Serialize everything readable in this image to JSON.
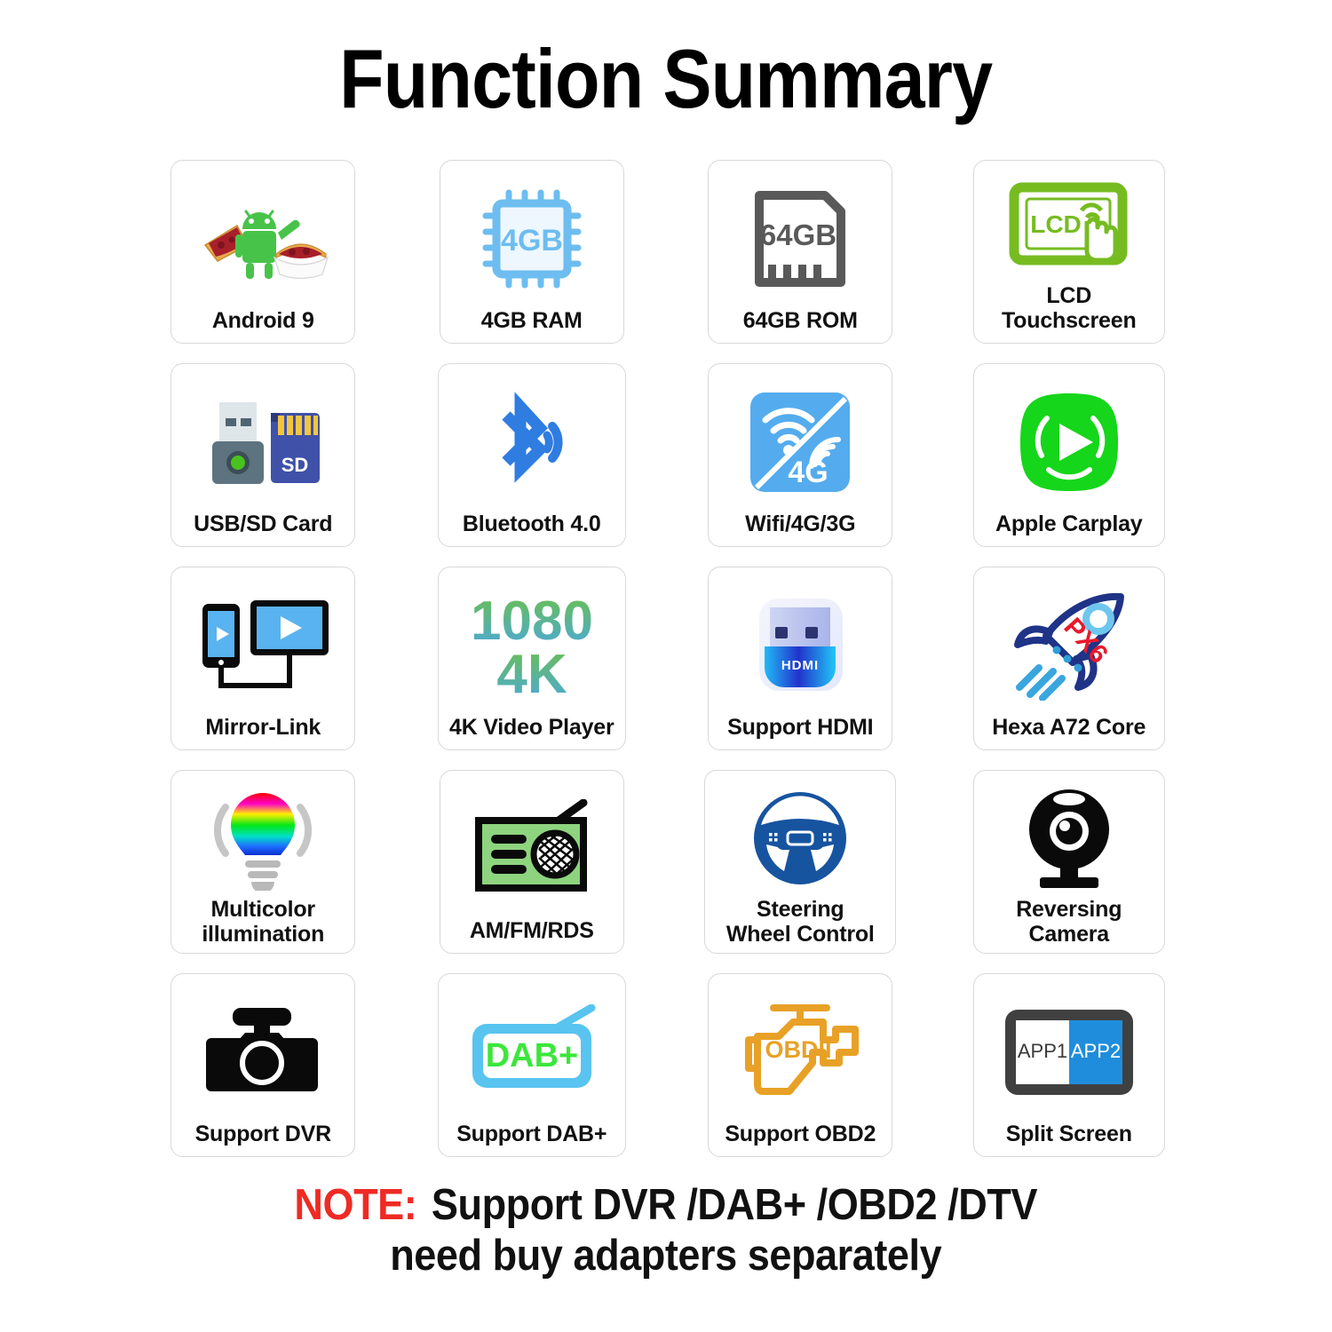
{
  "header": {
    "title": "Function Summary"
  },
  "features": [
    {
      "id": "android",
      "label": "Android 9",
      "icon": "android-pie-icon",
      "card_width": "normal"
    },
    {
      "id": "ram",
      "label": "4GB RAM",
      "icon": "cpu-chip-icon",
      "card_width": "normal",
      "badge": "4GB"
    },
    {
      "id": "rom",
      "label": "64GB ROM",
      "icon": "sd-card-icon",
      "card_width": "normal",
      "badge": "64GB"
    },
    {
      "id": "lcd",
      "label": "LCD Touchscreen",
      "icon": "lcd-touchscreen-icon",
      "card_width": "wider",
      "badge": "LCD"
    },
    {
      "id": "usbsd",
      "label": "USB/SD Card",
      "icon": "usb-sd-card-icon",
      "card_width": "normal",
      "badge": "SD"
    },
    {
      "id": "bluetooth",
      "label": "Bluetooth 4.0",
      "icon": "bluetooth-icon",
      "card_width": "wide"
    },
    {
      "id": "wifi",
      "label": "Wifi/4G/3G",
      "icon": "wifi-4g-icon",
      "card_width": "normal",
      "badge": "4G"
    },
    {
      "id": "carplay",
      "label": "Apple Carplay",
      "icon": "carplay-play-icon",
      "card_width": "wider"
    },
    {
      "id": "mirrorlink",
      "label": "Mirror-Link",
      "icon": "mirror-link-icon",
      "card_width": "normal"
    },
    {
      "id": "video4k",
      "label": "4K Video Player",
      "icon": "resolution-text-icon",
      "card_width": "wide",
      "badge": "1080",
      "badge2": "4K"
    },
    {
      "id": "hdmi",
      "label": "Support HDMI",
      "icon": "hdmi-dongle-icon",
      "card_width": "normal",
      "badge": "HDMI"
    },
    {
      "id": "hexacore",
      "label": "Hexa A72 Core",
      "icon": "rocket-icon",
      "card_width": "wider",
      "badge": "PX6"
    },
    {
      "id": "illumination",
      "label": "Multicolor\nillumination",
      "icon": "rainbow-bulb-icon",
      "card_width": "normal",
      "lines": 2
    },
    {
      "id": "radio",
      "label": "AM/FM/RDS",
      "icon": "radio-icon",
      "card_width": "normal"
    },
    {
      "id": "steering",
      "label": "Steering\nWheel Control",
      "icon": "steering-wheel-icon",
      "card_width": "wider",
      "lines": 2
    },
    {
      "id": "reversecam",
      "label": "Reversing\nCamera",
      "icon": "webcam-icon",
      "card_width": "wider",
      "lines": 2
    },
    {
      "id": "dvr",
      "label": "Support DVR",
      "icon": "dashcam-icon",
      "card_width": "normal"
    },
    {
      "id": "dab",
      "label": "Support DAB+",
      "icon": "dab-radio-icon",
      "card_width": "wide",
      "badge": "DAB+"
    },
    {
      "id": "obd2",
      "label": "Support OBD2",
      "icon": "engine-obd-icon",
      "card_width": "normal",
      "badge": "OBDII"
    },
    {
      "id": "splitscreen",
      "label": "Split Screen",
      "icon": "split-screen-icon",
      "card_width": "wider",
      "badge": "APP1",
      "badge2": "APP2"
    }
  ],
  "note": {
    "keyword": "NOTE:",
    "line1": "Support DVR /DAB+ /OBD2 /DTV",
    "line2": "need buy adapters separately"
  },
  "colors": {
    "android_green": "#3ddc84",
    "ram_blue": "#6dbdf0",
    "rom_gray": "#595959",
    "lcd_green": "#76bc21",
    "sd_blue": "#3f51a8",
    "bluetooth_blue": "#2f7de1",
    "wifi_blue": "#54acee",
    "carplay_green": "#15d61a",
    "mirror_blue": "#59b3f0",
    "gradient_top": "#6cc04a",
    "gradient_bottom": "#4aa8e0",
    "hdmi_blue": "#2233cc",
    "rocket_navy": "#1f3387",
    "rocket_red": "#e8192c",
    "radio_green": "#8ed47f",
    "steering_blue": "#17549f",
    "black": "#000000",
    "dab_blue": "#58c4ef",
    "dab_green": "#3ce63c",
    "obd_orange": "#e8a126",
    "split_dark": "#404040",
    "split_blue": "#1f8ddc",
    "note_red": "#ef2a24"
  }
}
